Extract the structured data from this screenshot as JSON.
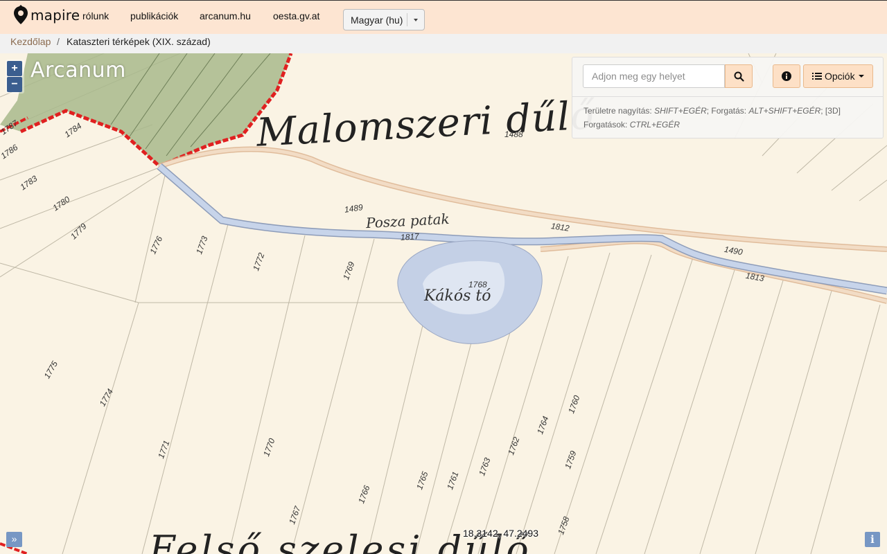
{
  "navbar": {
    "brand": "mapire",
    "links": [
      "rólunk",
      "publikációk",
      "arcanum.hu",
      "oesta.gv.at"
    ],
    "language": "Magyar (hu)",
    "colors": {
      "background": "#fde5d2"
    }
  },
  "breadcrumb": {
    "home": "Kezdőlap",
    "separator": "/",
    "current": "Kataszteri térképek (XIX. század)"
  },
  "map": {
    "overlay_logo": "Arcanum",
    "zoom_in": "+",
    "zoom_out": "−",
    "coordinates": "18.3142, 47.2493",
    "labels": {
      "region_top": "Malomszeri dűlő",
      "creek": "Posza patak",
      "pond": "Kákós tó",
      "region_bottom": "Felső szelesi dűlő"
    },
    "parcels": [
      "1488",
      "1489",
      "1490",
      "1812",
      "1813",
      "1817",
      "1768",
      "1776",
      "1773",
      "1772",
      "1769",
      "1775",
      "1774",
      "1771",
      "1770",
      "1767",
      "1766",
      "1765",
      "1764",
      "1763",
      "1762",
      "1761",
      "1760",
      "1759",
      "1758",
      "1780",
      "1779",
      "1783",
      "1784",
      "1786",
      "1787"
    ],
    "colors": {
      "water": "#c6d3ea",
      "road": "#e8c8a8",
      "forest": "#8fa86f",
      "border": "#e02020"
    }
  },
  "panel": {
    "search_placeholder": "Adjon meg egy helyet",
    "search_icon": "search-icon",
    "info_icon": "info-icon",
    "options_label": "Opciók",
    "hint1_prefix": "Területre nagyítás: ",
    "hint1_key": "SHIFT+EGÉR",
    "hint1_mid": "; Forgatás: ",
    "hint1_key2": "ALT+SHIFT+EGÉR",
    "hint1_suffix": "; [3D]",
    "hint2_prefix": "Forgatások: ",
    "hint2_key": "CTRL+EGÉR"
  },
  "footer": {
    "expand": "»",
    "info": "i"
  }
}
